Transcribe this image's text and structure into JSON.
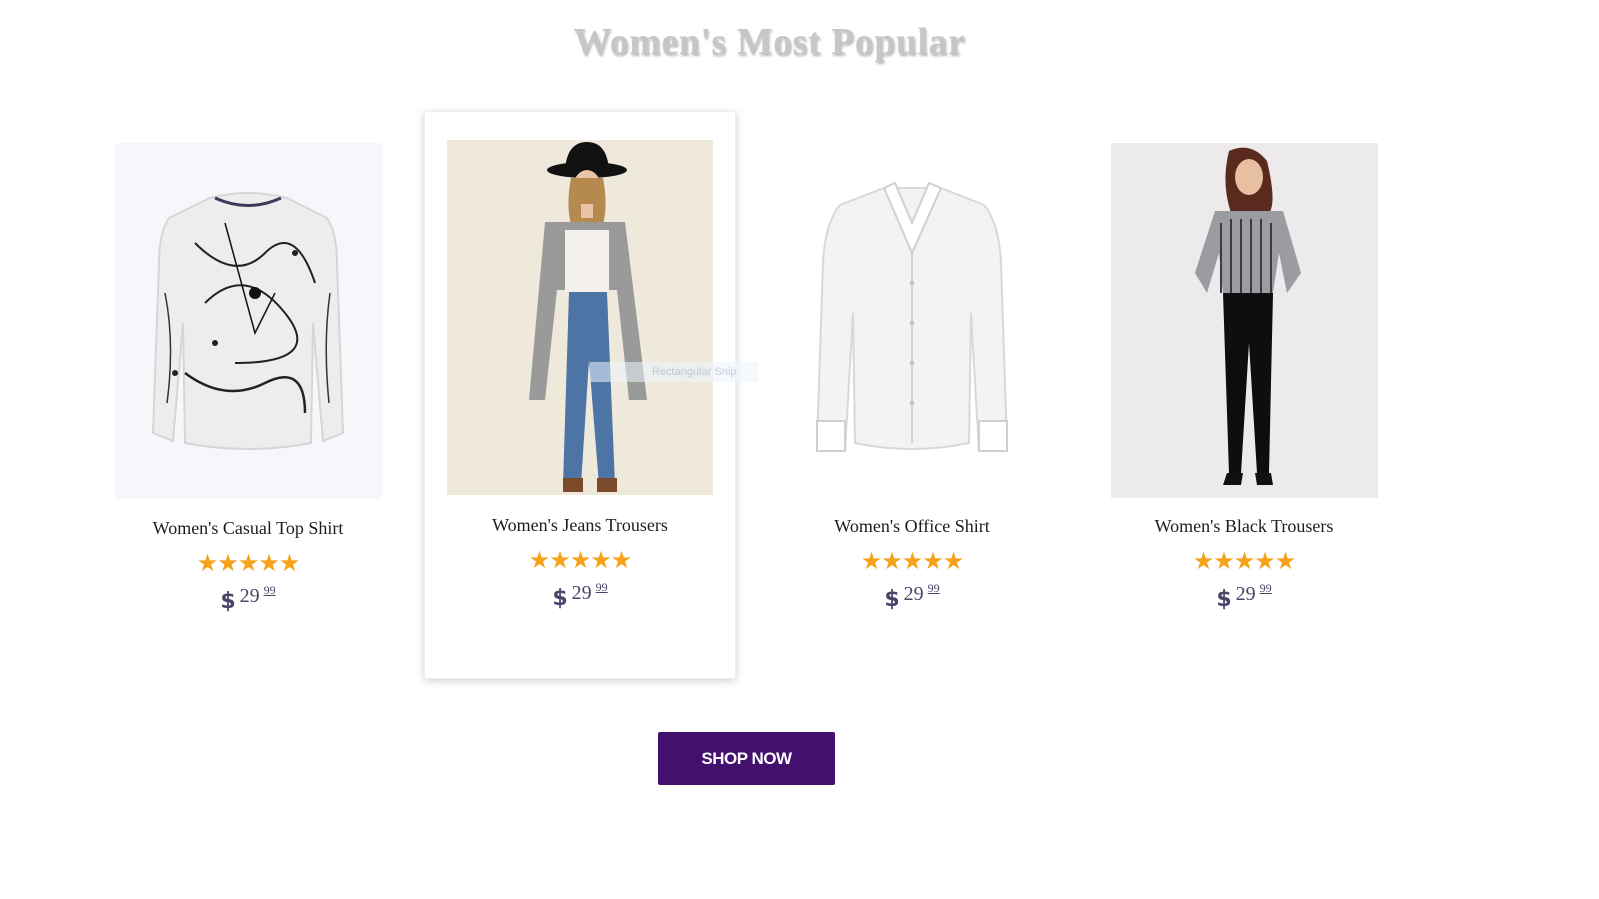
{
  "section": {
    "title": "Women's Most Popular"
  },
  "products": [
    {
      "name": "Women's Casual Top Shirt",
      "rating": 5,
      "stars": "★★★★★",
      "currency": "$",
      "price_whole": "29",
      "price_cents": "99",
      "image": "splatter-sweater"
    },
    {
      "name": "Women's Jeans Trousers",
      "rating": 5,
      "stars": "★★★★★",
      "currency": "$",
      "price_whole": "29",
      "price_cents": "99",
      "image": "model-cardigan-jeans"
    },
    {
      "name": "Women's Office Shirt",
      "rating": 5,
      "stars": "★★★★★",
      "currency": "$",
      "price_whole": "29",
      "price_cents": "99",
      "image": "white-shirt"
    },
    {
      "name": "Women's Black Trousers",
      "rating": 5,
      "stars": "★★★★★",
      "currency": "$",
      "price_whole": "29",
      "price_cents": "99",
      "image": "model-black-trousers"
    }
  ],
  "tooltip": {
    "text": "Rectangular Snip"
  },
  "cta": {
    "label": "SHOP NOW"
  },
  "colors": {
    "accent": "#43106d",
    "star": "#f7a21b",
    "price": "#4a4468",
    "title": "#c6c6c6"
  }
}
